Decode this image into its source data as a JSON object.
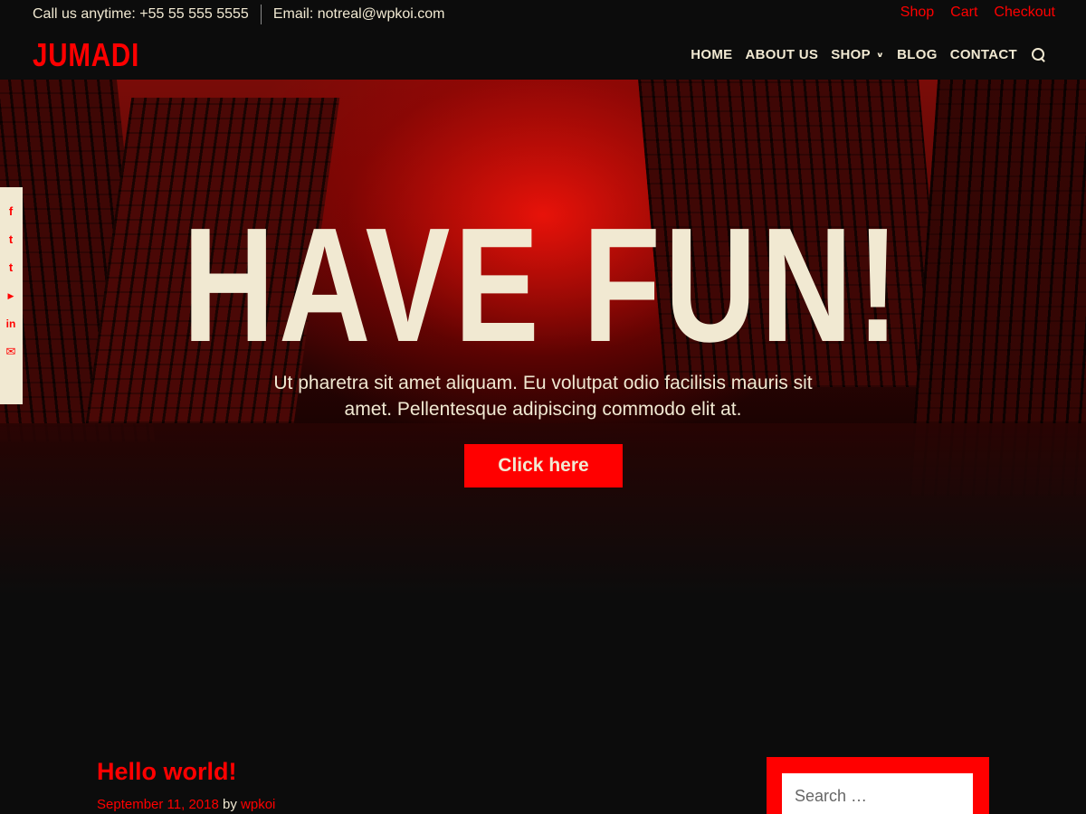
{
  "topbar": {
    "phone": "Call us anytime: +55 55 555 5555",
    "email": "Email: notreal@wpkoi.com",
    "links": [
      "Shop",
      "Cart",
      "Checkout"
    ]
  },
  "header": {
    "logo": "JUMADI",
    "nav": [
      "HOME",
      "ABOUT US",
      "SHOP",
      "BLOG",
      "CONTACT"
    ],
    "nav_icons": [
      "chevron-down-icon",
      "search-icon"
    ]
  },
  "hero": {
    "title": "HAVE FUN!",
    "text": "Ut pharetra sit amet aliquam. Eu volutpat odio facilisis mauris sit amet. Pellentesque adipiscing commodo elit at.",
    "button": "Click here"
  },
  "social": [
    "facebook-icon",
    "twitter-icon",
    "tumblr-icon",
    "youtube-icon",
    "linkedin-icon",
    "email-icon"
  ],
  "post": {
    "title": "Hello world!",
    "date": "September 11, 2018",
    "by": "by",
    "author": "wpkoi"
  },
  "sidebar": {
    "search_placeholder": "Search …"
  },
  "colors": {
    "accent": "#ff0000",
    "background": "#0c0c0c",
    "text": "#f1e9d2"
  }
}
